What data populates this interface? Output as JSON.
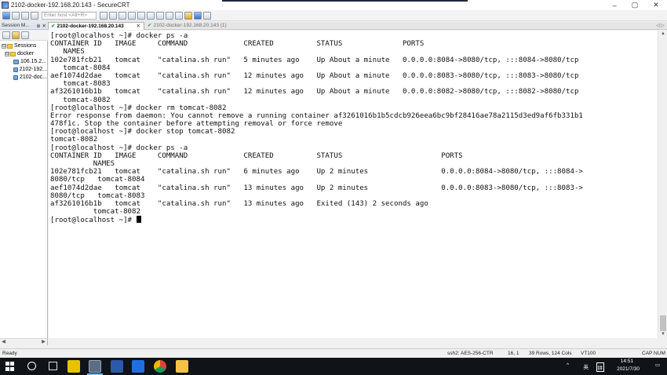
{
  "window": {
    "title": "2102-docker-192.168.20.143 - SecureCRT",
    "controls": [
      "–",
      "▢",
      "✕"
    ]
  },
  "toolbar": {
    "quick_connect_placeholder": "Enter host <Alt+R>"
  },
  "session_manager": {
    "title": "Session M...",
    "pin": "⊕",
    "close": "✕",
    "tree": [
      {
        "label": "Sessions",
        "type": "folder",
        "level": 0,
        "expander": "⊟"
      },
      {
        "label": "docker",
        "type": "folder",
        "level": 1,
        "expander": "⊟"
      },
      {
        "label": "106.15.2...",
        "type": "session",
        "level": 2
      },
      {
        "label": "2102-192...",
        "type": "session",
        "level": 2
      },
      {
        "label": "2102-doc...",
        "type": "session",
        "level": 2
      }
    ]
  },
  "tabs": [
    {
      "label": "2102-docker-192.168.20.143",
      "active": true,
      "close": "✕"
    },
    {
      "label": "2102-docker-192.168.20.143 (1)",
      "active": false
    }
  ],
  "tab_nav": "◁ ▷",
  "terminal": {
    "lines": [
      "[root@localhost ~]# docker ps -a",
      "CONTAINER ID   IMAGE     COMMAND             CREATED          STATUS              PORTS",
      "   NAMES",
      "102e781fcb21   tomcat    \"catalina.sh run\"   5 minutes ago    Up About a minute   0.0.0.0:8084->8080/tcp, :::8084->8080/tcp",
      "   tomcat-8084",
      "aef1074d2dae   tomcat    \"catalina.sh run\"   12 minutes ago   Up About a minute   0.0.0.0:8083->8080/tcp, :::8083->8080/tcp",
      "   tomcat-8083",
      "af3261016b1b   tomcat    \"catalina.sh run\"   12 minutes ago   Up About a minute   0.0.0.0:8082->8080/tcp, :::8082->8080/tcp",
      "   tomcat-8082",
      "[root@localhost ~]# docker rm tomcat-8082",
      "Error response from daemon: You cannot remove a running container af3261016b1b5cdcb926eea6bc9bf28416ae78a2115d3ed9af6fb331b1",
      "478f1c. Stop the container before attempting removal or force remove",
      "[root@localhost ~]# docker stop tomcat-8082",
      "tomcat-8082",
      "[root@localhost ~]# docker ps -a",
      "CONTAINER ID   IMAGE     COMMAND             CREATED          STATUS                       PORTS",
      "          NAMES",
      "102e781fcb21   tomcat    \"catalina.sh run\"   6 minutes ago    Up 2 minutes                 0.0.0.0:8084->8080/tcp, :::8084->",
      "8080/tcp   tomcat-8084",
      "aef1074d2dae   tomcat    \"catalina.sh run\"   13 minutes ago   Up 2 minutes                 0.0.0.0:8083->8080/tcp, :::8083->",
      "8080/tcp   tomcat-8083",
      "af3261016b1b   tomcat    \"catalina.sh run\"   13 minutes ago   Exited (143) 2 seconds ago",
      "          tomcat-8082"
    ],
    "prompt": "[root@localhost ~]# "
  },
  "status_bar": {
    "ready": "Ready",
    "cipher": "ssh2: AES-256-CTR",
    "position": "16,  1",
    "size": "39 Rows, 124 Cols",
    "emulation": "VT100",
    "caps_num": "CAP NUM"
  },
  "taskbar": {
    "tray_chevron": "^",
    "ime_lang": "英",
    "ime_mode": "拼",
    "time": "14:51",
    "date": "2021/7/30",
    "notification": "▭"
  },
  "colors": {
    "accent": "#76b9ed",
    "terminal_bg": "#ffffff",
    "terminal_fg": "#111111",
    "tab_check": "#2e9b3a"
  }
}
